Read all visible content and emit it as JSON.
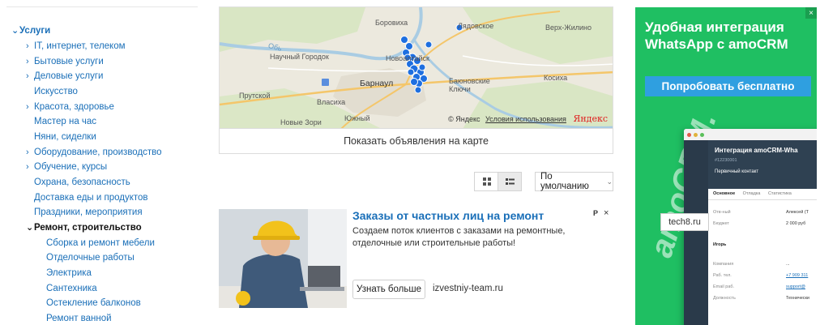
{
  "sidebar": {
    "services": "Услуги",
    "items": [
      {
        "label": "IT, интернет, телеком",
        "arrow": true
      },
      {
        "label": "Бытовые услуги",
        "arrow": true
      },
      {
        "label": "Деловые услуги",
        "arrow": true
      },
      {
        "label": "Искусство",
        "arrow": false
      },
      {
        "label": "Красота, здоровье",
        "arrow": true
      },
      {
        "label": "Мастер на час",
        "arrow": false
      },
      {
        "label": "Няни, сиделки",
        "arrow": false
      },
      {
        "label": "Оборудование, производство",
        "arrow": true
      },
      {
        "label": "Обучение, курсы",
        "arrow": true
      },
      {
        "label": "Охрана, безопасность",
        "arrow": false
      },
      {
        "label": "Доставка еды и продуктов",
        "arrow": false
      },
      {
        "label": "Праздники, мероприятия",
        "arrow": false
      }
    ],
    "active": "Ремонт, строительство",
    "subitems": [
      "Сборка и ремонт мебели",
      "Отделочные работы",
      "Электрика",
      "Сантехника",
      "Остекление балконов",
      "Ремонт ванной"
    ]
  },
  "map": {
    "labels": {
      "borovikha": "Боровиха",
      "lyudovskoe": "Лядовское",
      "verkh_zhilino": "Верх-Жилино",
      "nauchny": "Научный Городок",
      "novoaltaysk": "Новоалтайск",
      "barnaul": "Барнаул",
      "barnaul_obl": "Баюновские Ключи",
      "kosikha": "Косиха",
      "prutskoy": "Прутской",
      "vlasikha": "Власиха",
      "yuzhny": "Южный",
      "novye_zori": "Новые Зори",
      "ob": "Обь"
    },
    "copyright": "© Яндекс",
    "terms": "Условия использования",
    "brand": "Яндекс",
    "show_on_map": "Показать объявления на карте"
  },
  "controls": {
    "sort_label": "По умолчанию"
  },
  "ad": {
    "title": "Заказы от частных лиц на ремонт",
    "text": "Создаем поток клиентов с заказами на ремонтные, отделочные или строительные работы!",
    "button": "Узнать больше",
    "domain": "izvestniy-team.ru",
    "marker": "P",
    "close": "×"
  },
  "banner": {
    "title": "Удобная интеграция WhatsApp с amoCRM",
    "cta": "Попробовать бесплатно",
    "close": "×",
    "shot_title": "Интеграция amoCRM-Wha",
    "shot_sub": "#12230001",
    "shot_stage": "Первичный контакт",
    "shot_tabs": [
      "Основное",
      "Отладка",
      "Статистика"
    ],
    "rows": [
      {
        "k": "Отв-ный",
        "v": "Алексей (Т"
      },
      {
        "k": "Бюджет",
        "v": "2 000 руб"
      },
      {
        "k": "Игорь",
        "v": ""
      },
      {
        "k": "Компания",
        "v": "..."
      },
      {
        "k": "Раб. тел.",
        "v": "+7 909 311"
      },
      {
        "k": "Email раб.",
        "v": "support@"
      },
      {
        "k": "Должность",
        "v": "Технически"
      }
    ],
    "logo": "amoCRM.",
    "watermark": "tech8.ru"
  },
  "colors": {
    "link": "#1a6fb8",
    "banner_green": "#1fbf62",
    "banner_cta": "#2f9fe0",
    "map_marker": "#1e6fe0"
  }
}
